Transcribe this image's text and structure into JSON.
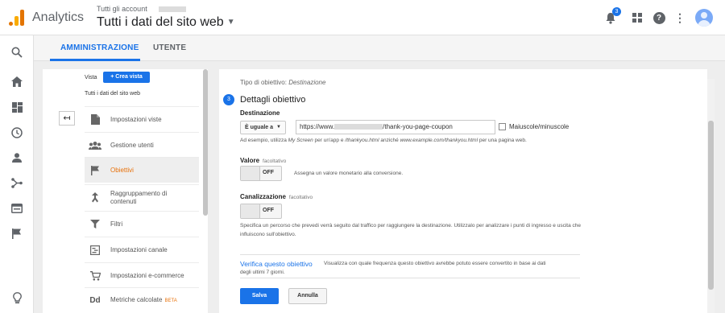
{
  "header": {
    "app_title": "Analytics",
    "breadcrumb_small": "Tutti gli account",
    "breadcrumb_main": "Tutti i dati del sito web",
    "notification_count": "3"
  },
  "tabs": [
    {
      "label": "AMMINISTRAZIONE"
    },
    {
      "label": "UTENTE"
    }
  ],
  "view": {
    "label": "Vista",
    "create_button": "+ Crea vista",
    "current": "Tutti i dati del sito web"
  },
  "nav": {
    "items": [
      {
        "label": "Impostazioni viste"
      },
      {
        "label": "Gestione utenti"
      },
      {
        "label": "Obiettivi"
      },
      {
        "label": "Raggruppamento di contenuti"
      },
      {
        "label": "Filtri"
      },
      {
        "label": "Impostazioni canale"
      },
      {
        "label": "Impostazioni e-commerce"
      },
      {
        "label": "Metriche calcolate",
        "badge": "BETA"
      }
    ]
  },
  "form": {
    "goal_type_prefix": "Tipo di obiettivo:",
    "goal_type_value": "Destinazione",
    "step_number": "3",
    "section_title": "Dettagli obiettivo",
    "destination_label": "Destinazione",
    "match_select": "È uguale a",
    "url_prefix": "https://www.",
    "url_suffix": "/thank-you-page-coupon",
    "case_sensitive_label": "Maiuscole/minuscole",
    "hint": {
      "prefix": "Ad esempio, utilizza ",
      "my_screen": "My Screen",
      "middle": " per un'app e ",
      "thankyou": "/thankyou.html",
      "anziche": " anziché ",
      "example": "www.example.com/thankyou.html",
      "suffix": " per una pagina web."
    },
    "value_label": "Valore",
    "value_optional": "facoltativo",
    "value_toggle": "OFF",
    "value_desc": "Assegna un valore monetario alla conversione.",
    "funnel_label": "Canalizzazione",
    "funnel_optional": "facoltativo",
    "funnel_toggle": "OFF",
    "funnel_desc": "Specifica un percorso che prevedi verrà seguito dal traffico per raggiungere la destinazione. Utilizzalo per analizzare i punti di ingresso e uscita che influiscono sull'obiettivo.",
    "verify_link": "Verifica questo obiettivo",
    "verify_desc_1": "Visualizza con quale frequenza questo obiettivo avrebbe potuto essere convertito in base ai dati",
    "verify_desc_2": "degli ultimi 7 giorni.",
    "save_button": "Salva",
    "cancel_button": "Annulla"
  },
  "colors": {
    "accent": "#1a73e8",
    "active_nav": "#e8710a",
    "logo_orange": "#e37400",
    "logo_yellow": "#f9ab00"
  }
}
